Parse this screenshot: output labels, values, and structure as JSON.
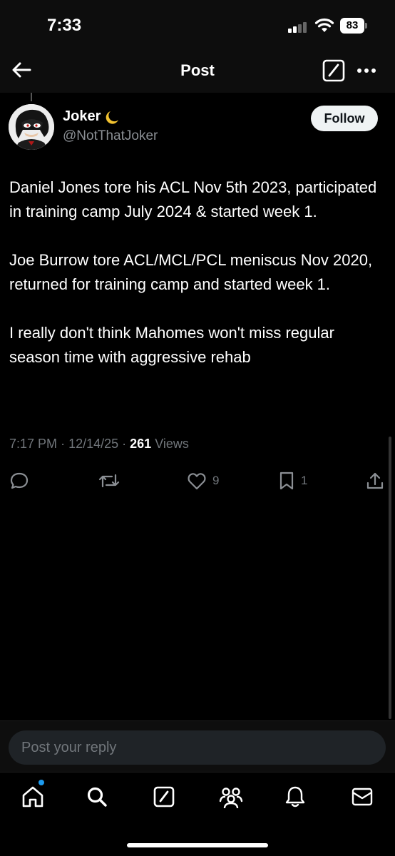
{
  "status_bar": {
    "time": "7:33",
    "battery": "83",
    "icons": [
      "signal-icon",
      "wifi-icon",
      "battery-icon"
    ]
  },
  "nav": {
    "title": "Post",
    "icons": [
      "back-arrow-icon",
      "compose-icon",
      "more-icon"
    ]
  },
  "post": {
    "author": {
      "name": "Joker",
      "emoji_icon": "crescent-moon-icon",
      "handle": "@NotThatJoker"
    },
    "follow_label": "Follow",
    "paragraphs": [
      "Daniel Jones tore his ACL Nov 5th 2023, participated in training camp July 2024 & started week 1.",
      "Joe Burrow tore ACL/MCL/PCL meniscus Nov 2020, returned for training camp and started week 1.",
      "I really don't think Mahomes won't miss regular season time with aggressive rehab"
    ],
    "meta": {
      "time": "7:17 PM",
      "date": "12/14/25",
      "views_count": "261",
      "views_label": "Views"
    },
    "actions": {
      "reply_count": "",
      "repost_count": "",
      "like_count": "9",
      "bookmark_count": "1"
    }
  },
  "reply": {
    "placeholder": "Post your reply"
  },
  "tabs": [
    "home-icon",
    "search-icon",
    "compose-icon",
    "communities-icon",
    "notifications-icon",
    "messages-icon"
  ],
  "colors": {
    "background": "#000000",
    "text": "#e7e9ea",
    "muted": "#71767b",
    "accent": "#1d9bf0"
  }
}
